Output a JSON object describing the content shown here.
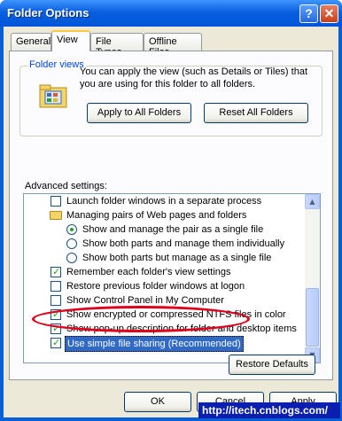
{
  "window": {
    "title": "Folder Options",
    "help_label": "?",
    "close_label": "✕"
  },
  "tabs": [
    {
      "label": "General"
    },
    {
      "label": "View"
    },
    {
      "label": "File Types"
    },
    {
      "label": "Offline Files"
    }
  ],
  "folder_views": {
    "title": "Folder views",
    "description": "You can apply the view (such as Details or Tiles) that you are using for this folder to all folders.",
    "apply_label": "Apply to All Folders",
    "reset_label": "Reset All Folders"
  },
  "advanced": {
    "label": "Advanced settings:",
    "items": [
      {
        "type": "checkbox",
        "checked": false,
        "label": "Launch folder windows in a separate process"
      },
      {
        "type": "folder",
        "label": "Managing pairs of Web pages and folders"
      },
      {
        "type": "radio",
        "checked": true,
        "label": "Show and manage the pair as a single file"
      },
      {
        "type": "radio",
        "checked": false,
        "label": "Show both parts and manage them individually"
      },
      {
        "type": "radio",
        "checked": false,
        "label": "Show both parts but manage as a single file"
      },
      {
        "type": "checkbox",
        "checked": true,
        "label": "Remember each folder's view settings"
      },
      {
        "type": "checkbox",
        "checked": false,
        "label": "Restore previous folder windows at logon"
      },
      {
        "type": "checkbox",
        "checked": false,
        "label": "Show Control Panel in My Computer"
      },
      {
        "type": "checkbox",
        "checked": true,
        "label": "Show encrypted or compressed NTFS files in color"
      },
      {
        "type": "checkbox",
        "checked": true,
        "label": "Show pop-up description for folder and desktop items"
      },
      {
        "type": "checkbox",
        "checked": true,
        "label": "Use simple file sharing (Recommended)"
      }
    ],
    "restore_label": "Restore Defaults"
  },
  "footer": {
    "ok_label": "OK",
    "cancel_label": "Cancel",
    "apply_label": "Apply"
  },
  "watermark": "http://itech.cnblogs.com/"
}
